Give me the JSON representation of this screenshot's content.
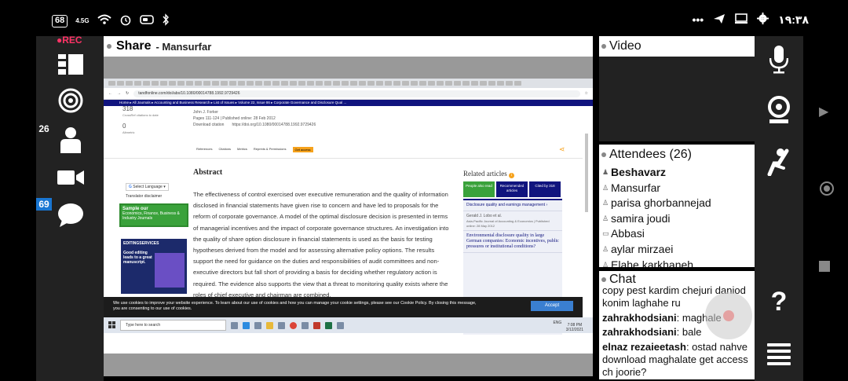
{
  "status_bar": {
    "battery": "68",
    "network": "4.5G",
    "time": "١٩:٣٨",
    "dots": "•••"
  },
  "left_bar": {
    "rec_label": "REC",
    "attendees_badge": "26",
    "chat_badge": "69"
  },
  "share": {
    "title": "Share",
    "presenter": "- Mansurfar"
  },
  "browser": {
    "url": "tandfonline.com/doi/abs/10.1080/00014788.1992.9729426",
    "breadcrumb": "Home  ▸  All Journals  ▸  Accounting and Business Research  ▸  List of Issues  ▸  Volume 22, Issue 86  ▸  Corporate Governance and Disclosure Qual ..."
  },
  "article": {
    "views_count": "318",
    "views_label": "CrossRef citations to date",
    "altmetric_count": "0",
    "altmetric_label": "Altmetric",
    "author": "John J. Forker",
    "pages_line": "Pages 111-124  |  Published online: 28 Feb 2012",
    "download_citation": "Download citation",
    "doi": "https://doi.org/10.1080/00014788.1992.9729426",
    "links": [
      "References",
      "Citations",
      "Metrics",
      "Reprints & Permissions"
    ],
    "get_access": "Get access",
    "abstract_title": "Abstract",
    "abstract_text": "The effectiveness of control exercised over executive remuneration and the quality of information disclosed in financial statements have given rise to concern and have led to proposals for the reform of corporate governance. A model of the optimal disclosure decision is presented in terms of managerial incentives and the impact of corporate governance structures. An investigation into the quality of share option disclosure in financial statements is used as the basis for testing hypotheses derived from the model and for assessing alternative policy options. The results support the need for guidance on the duties and responsibilities of audit committees and non-executive directors but fall short of providing a basis for deciding whether regulatory action is required. The evidence also supports the view that a threat to monitoring quality exists where the roles of chief executive and chairman are combined.",
    "select_language": "Select Language",
    "translator": "Translator disclaimer",
    "sample_title": "Sample our",
    "sample_sub": "Economics, Finance, Business & Industry Journals",
    "ad_brand": "EDITINGSERVICES",
    "ad_text": "Good editing leads to a great manuscript."
  },
  "related": {
    "title": "Related articles",
    "tabs": [
      "People also read",
      "Recommended articles",
      "Cited by 318"
    ],
    "items": [
      {
        "title": "Disclosure quality and earnings management  ›",
        "meta": ""
      },
      {
        "title": "Gerald J. Lobo et al.",
        "meta": "Asia-Pacific Journal of Accounting & Economics | Published online: 28 May 2012"
      },
      {
        "title": "Environmental disclosure quality in large German companies: Economic incentives, public pressures or institutional conditions?",
        "meta": ""
      }
    ]
  },
  "cookie": {
    "text": "We use cookies to improve your website experience. To learn about our use of cookies and how you can manage your cookie settings, please see our Cookie Policy. By closing this message, you are consenting to our use of cookies.",
    "accept": "Accept"
  },
  "taskbar": {
    "search_placeholder": "Type here to search",
    "lang": "ENG",
    "time": "7:08 PM",
    "date": "3/12/2021"
  },
  "video": {
    "title": "Video"
  },
  "attendees": {
    "title": "Attendees (26)",
    "list": [
      {
        "name": "Beshavarz",
        "host": true
      },
      {
        "name": "Mansurfar",
        "host": false
      },
      {
        "name": "parisa ghorbannejad",
        "host": false
      },
      {
        "name": "samira joudi",
        "host": false
      },
      {
        "name": "Abbasi",
        "host": false
      },
      {
        "name": "aylar mirzaei",
        "host": false
      },
      {
        "name": "Elahe karkhaneh",
        "host": false
      }
    ]
  },
  "chat": {
    "title": "Chat",
    "messages": [
      {
        "sender": "",
        "text": "copy pest kardim chejuri daniod konim laghahe ru"
      },
      {
        "sender": "zahrakhodsiani",
        "text": ": maghale"
      },
      {
        "sender": "zahrakhodsiani",
        "text": ": bale"
      },
      {
        "sender": "elnaz rezaieetash",
        "text": ": ostad nahve download maghalate get access ch joorie?"
      }
    ]
  }
}
